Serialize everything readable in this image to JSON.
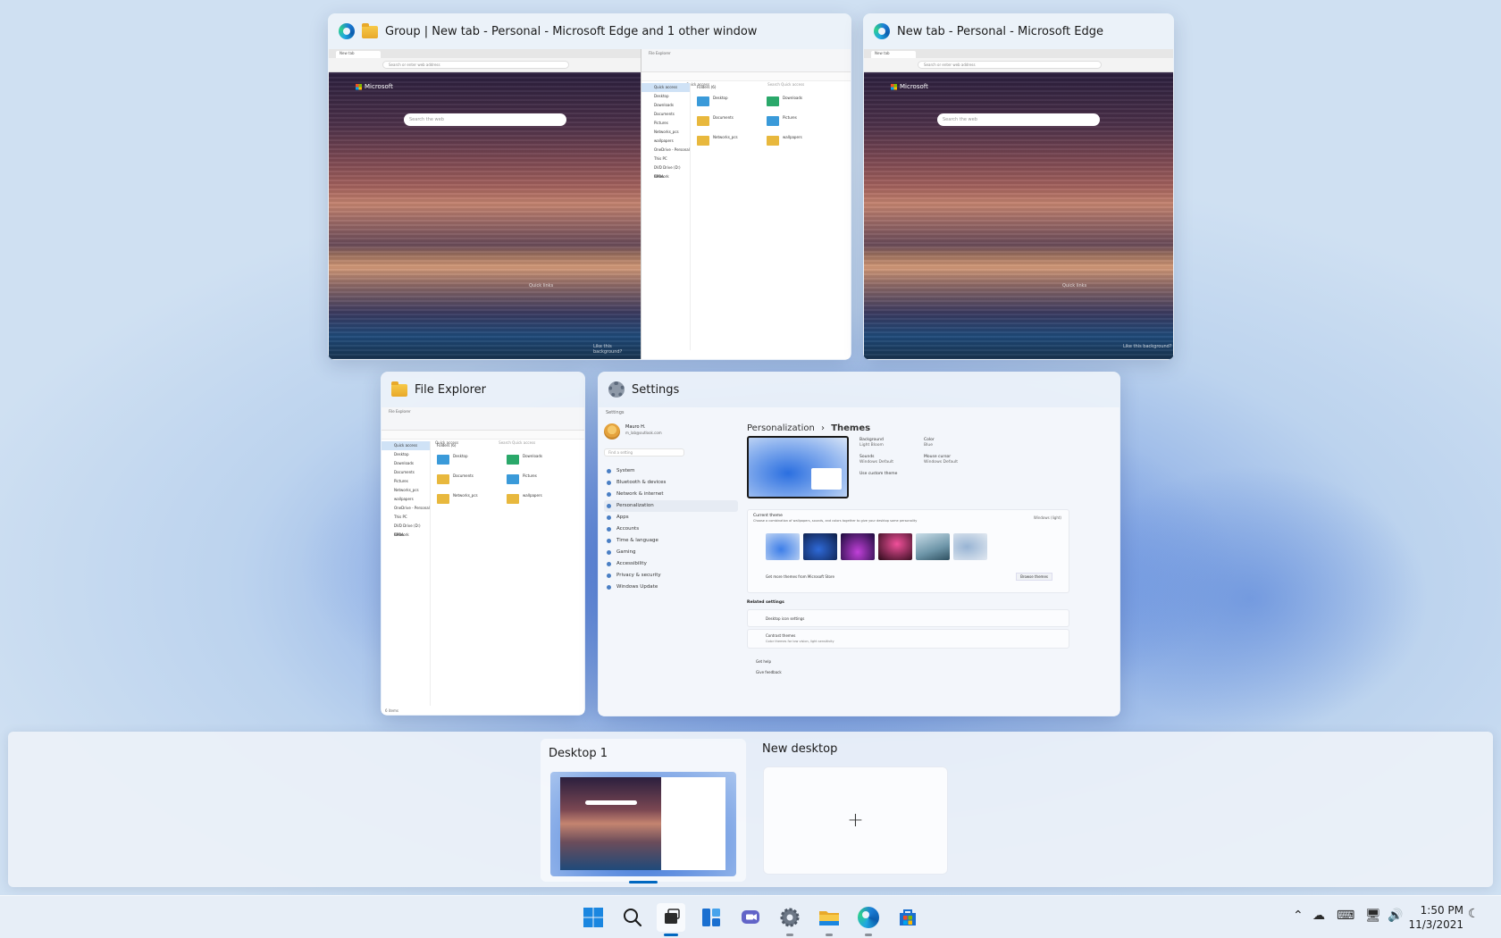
{
  "windows": {
    "edge_group": {
      "title": "Group | New tab - Personal - Microsoft Edge and 1 other window",
      "edge_tab_label": "New tab",
      "address_placeholder": "Search or enter web address",
      "ntp_brand": "Microsoft",
      "ntp_search_placeholder": "Search the web",
      "ntp_quick_links": "Quick links",
      "ntp_like_bg": "Like this background?",
      "explorer_title": "File Explorer",
      "explorer_quick_access": "Quick access",
      "explorer_search": "Search Quick access",
      "explorer_section": "Folders (6)"
    },
    "edge_single": {
      "title": "New tab - Personal - Microsoft Edge",
      "edge_tab_label": "New tab",
      "address_placeholder": "Search or enter web address",
      "ntp_brand": "Microsoft",
      "ntp_search_placeholder": "Search the web",
      "ntp_quick_links": "Quick links",
      "ntp_like_bg": "Like this background?"
    },
    "file_explorer": {
      "title": "File Explorer",
      "quick_access": "Quick access",
      "search": "Search Quick access",
      "section": "Folders (6)",
      "sidebar": [
        "Quick access",
        "Desktop",
        "Downloads",
        "Documents",
        "Pictures",
        "Networks_pcs",
        "wallpapers",
        "OneDrive - Personal",
        "This PC",
        "DVD Drive (D:) CPBA",
        "Network"
      ],
      "folders": [
        {
          "name": "Desktop",
          "sub": "This PC",
          "color": "blue"
        },
        {
          "name": "Downloads",
          "sub": "This PC",
          "color": "green"
        },
        {
          "name": "Documents",
          "sub": "This PC",
          "color": "yellow"
        },
        {
          "name": "Pictures",
          "sub": "This PC",
          "color": "blue"
        },
        {
          "name": "Networks_pcs",
          "sub": "C:\\Users\\Mauro",
          "color": "yellow"
        },
        {
          "name": "wallpapers",
          "sub": "C:\\Users\\Mauro\\Downloads",
          "color": "yellow"
        }
      ],
      "status": "6 items"
    },
    "settings": {
      "title": "Settings",
      "app_label": "Settings",
      "user_name": "Mauro H.",
      "user_email": "m_lab@outlook.com",
      "find_setting": "Find a setting",
      "nav": [
        "System",
        "Bluetooth & devices",
        "Network & internet",
        "Personalization",
        "Apps",
        "Accounts",
        "Time & language",
        "Gaming",
        "Accessibility",
        "Privacy & security",
        "Windows Update"
      ],
      "nav_selected": "Personalization",
      "breadcrumb_parent": "Personalization",
      "breadcrumb_sep": "›",
      "breadcrumb_current": "Themes",
      "props": [
        {
          "label": "Background",
          "value": "Light Bloom"
        },
        {
          "label": "Color",
          "value": "Blue"
        },
        {
          "label": "Sounds",
          "value": "Windows Default"
        },
        {
          "label": "Mouse cursor",
          "value": "Windows Default"
        }
      ],
      "use_custom_theme": "Use custom theme",
      "current_theme_title": "Current theme",
      "current_theme_desc": "Choose a combination of wallpapers, sounds, and colors together to give your desktop some personality",
      "current_theme_value": "Windows (light)",
      "get_more_themes": "Get more themes from Microsoft Store",
      "browse_themes": "Browse themes",
      "related_settings": "Related settings",
      "desktop_icon_settings": "Desktop icon settings",
      "contrast_themes": "Contrast themes",
      "contrast_desc": "Color themes for low vision, light sensitivity",
      "get_help": "Get help",
      "give_feedback": "Give feedback"
    }
  },
  "desktops": [
    {
      "label": "Desktop 1",
      "selected": true
    },
    {
      "label": "New desktop",
      "add_glyph": "+"
    }
  ],
  "taskbar": {
    "apps": [
      "windows-start-icon",
      "search-icon",
      "task-view-icon",
      "widgets-icon",
      "chat-icon",
      "settings-icon",
      "file-explorer-icon",
      "edge-icon",
      "store-icon"
    ],
    "time": "1:50 PM",
    "date": "11/3/2021"
  },
  "colors": {
    "accent": "#0067c0",
    "wallpaper": "#8fb0e6"
  }
}
